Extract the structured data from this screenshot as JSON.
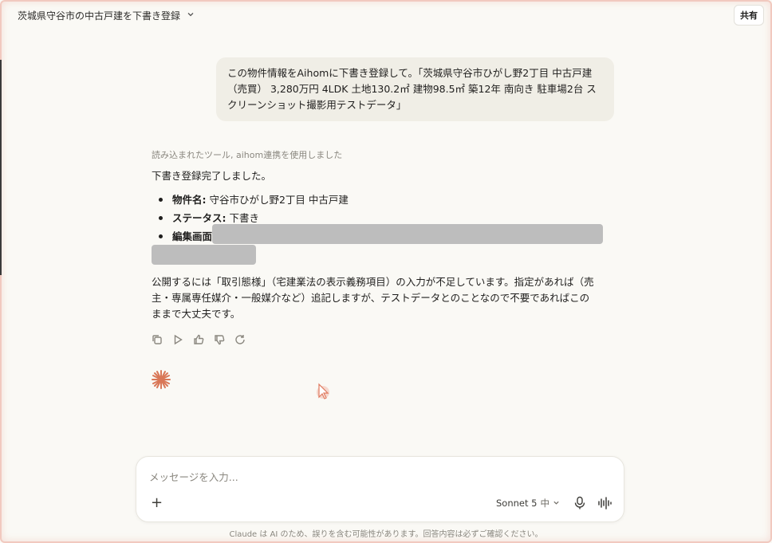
{
  "header": {
    "title": "茨城県守谷市の中古戸建を下書き登録",
    "share_label": "共有"
  },
  "user_message": "この物件情報をAihomに下書き登録して。「茨城県守谷市ひがし野2丁目 中古戸建（売買） 3,280万円 4LDK 土地130.2㎡ 建物98.5㎡ 築12年 南向き 駐車場2台 スクリーンショット撮影用テストデータ」",
  "assistant": {
    "tools_used": "読み込まれたツール, aihom連携を使用しました",
    "intro": "下書き登録完了しました。",
    "items": [
      {
        "label": "物件名:",
        "value": " 守谷市ひがし野2丁目 中古戸建"
      },
      {
        "label": "ステータス:",
        "value": " 下書き"
      },
      {
        "label": "編集画面",
        "value": ""
      }
    ],
    "paragraph": "公開するには「取引態様」（宅建業法の表示義務項目）の入力が不足しています。指定があれば（売主・専属専任媒介・一般媒介など）追記しますが、テストデータとのことなので不要であればこのままで大丈夫です。"
  },
  "action_icons": [
    "copy-icon",
    "play-icon",
    "thumbs-up-icon",
    "thumbs-down-icon",
    "retry-icon"
  ],
  "composer": {
    "placeholder": "メッセージを入力...",
    "value": "",
    "plus_label": "+",
    "model_name": "Sonnet 5",
    "effort": "中"
  },
  "footer_note": "Claude は AI のため、誤りを含む可能性があります。回答内容は必ずご確認ください。",
  "colors": {
    "background": "#faf9f5",
    "bubble": "#f0eee6",
    "accent": "#d97757",
    "redaction": "#bdbdbd"
  }
}
